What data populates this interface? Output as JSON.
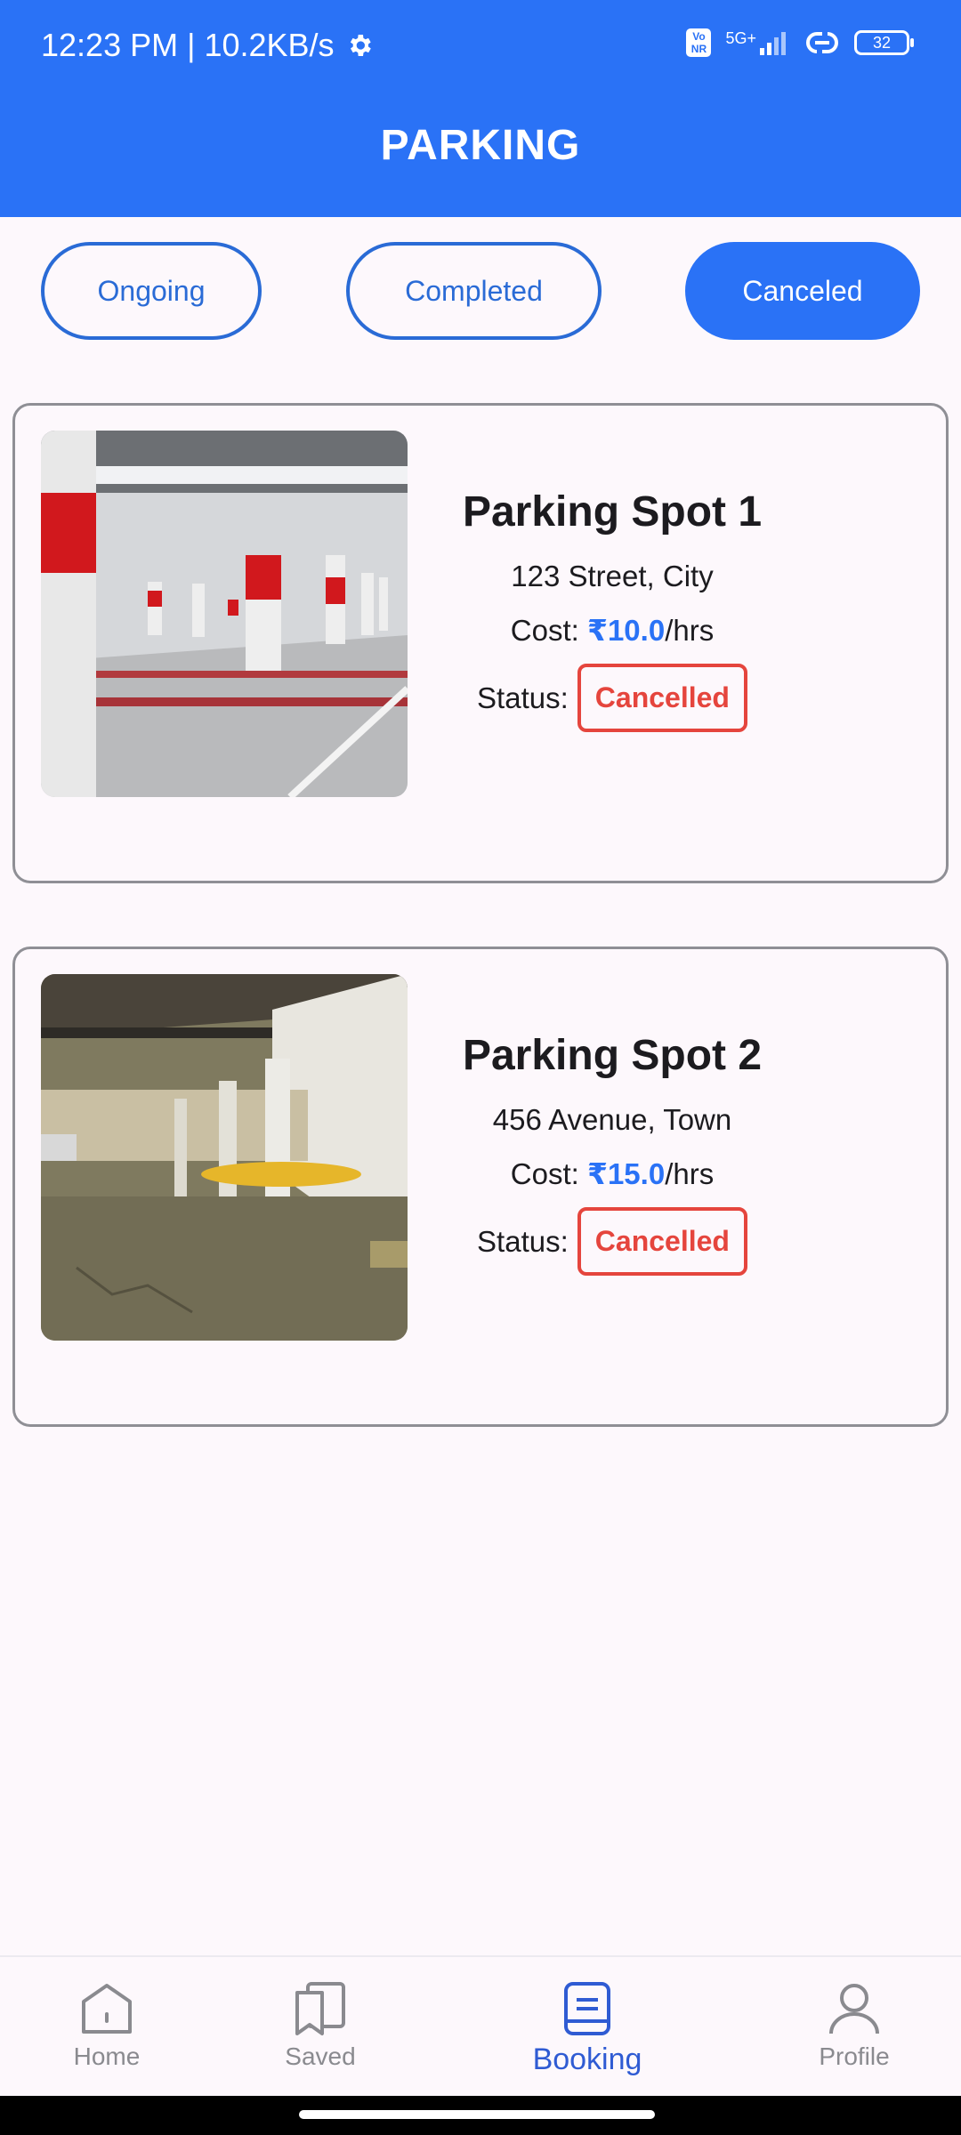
{
  "status_bar": {
    "time_speed": "12:23 PM | 10.2KB/s",
    "volte": "Vo NR",
    "network": "5G+",
    "battery": "32"
  },
  "app": {
    "title": "PARKING"
  },
  "tabs": [
    {
      "label": "Ongoing",
      "active": false
    },
    {
      "label": "Completed",
      "active": false
    },
    {
      "label": "Canceled",
      "active": true
    }
  ],
  "bookings": [
    {
      "name": "Parking Spot 1",
      "address": "123 Street, City",
      "cost_prefix": "Cost: ",
      "price": "₹10.0",
      "unit": "/hrs",
      "status_label": "Status:",
      "status": "Cancelled"
    },
    {
      "name": "Parking Spot 2",
      "address": "456 Avenue, Town",
      "cost_prefix": "Cost: ",
      "price": "₹15.0",
      "unit": "/hrs",
      "status_label": "Status:",
      "status": "Cancelled"
    }
  ],
  "bottom_nav": [
    {
      "label": "Home",
      "icon": "home-icon",
      "active": false
    },
    {
      "label": "Saved",
      "icon": "saved-icon",
      "active": false
    },
    {
      "label": "Booking",
      "icon": "booking-icon",
      "active": true
    },
    {
      "label": "Profile",
      "icon": "profile-icon",
      "active": false
    }
  ],
  "colors": {
    "primary": "#2a72f6",
    "cancelled": "#e5453d",
    "background": "#fdf8fc"
  }
}
